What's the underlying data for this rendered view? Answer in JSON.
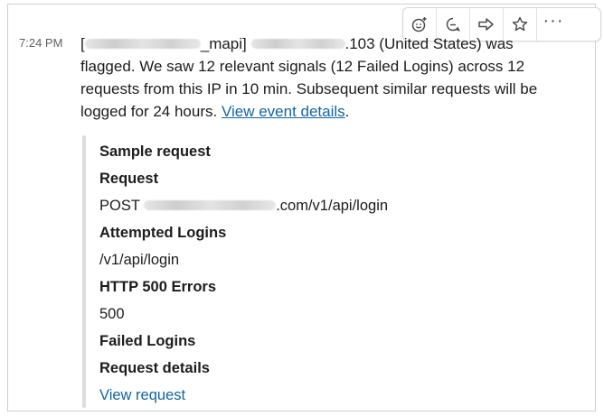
{
  "toolbar": {
    "icons": [
      "add-reaction-icon",
      "reply-thread-icon",
      "share-message-icon",
      "save-star-icon",
      "more-actions-icon"
    ],
    "more_label": "···"
  },
  "message": {
    "timestamp": "7:24 PM",
    "bracket_open": "[",
    "user_suffix": "_mapi]",
    "ip_tail": ".103 (United States) was",
    "body_line2": "flagged. We saw 12 relevant signals (12 Failed Logins) across 12",
    "body_line3": "requests from this IP in 10 min. Subsequent similar requests will be",
    "body_line4_prefix": "logged for 24 hours. ",
    "link_text": "View event details",
    "body_line4_suffix": "."
  },
  "attachment": {
    "sample_request_label": "Sample request",
    "request_label": "Request",
    "request_method": "POST ",
    "request_path": ".com/v1/api/login",
    "attempted_logins_label": "Attempted Logins",
    "attempted_logins_value": "/v1/api/login",
    "http500_label": "HTTP 500 Errors",
    "http500_value": "500",
    "failed_logins_label": "Failed Logins",
    "request_details_label": "Request details",
    "view_request_link": "View request"
  },
  "colors": {
    "link": "#1264a3",
    "text": "#1d1c1d",
    "muted": "#616061",
    "border": "#cfcfcf"
  }
}
